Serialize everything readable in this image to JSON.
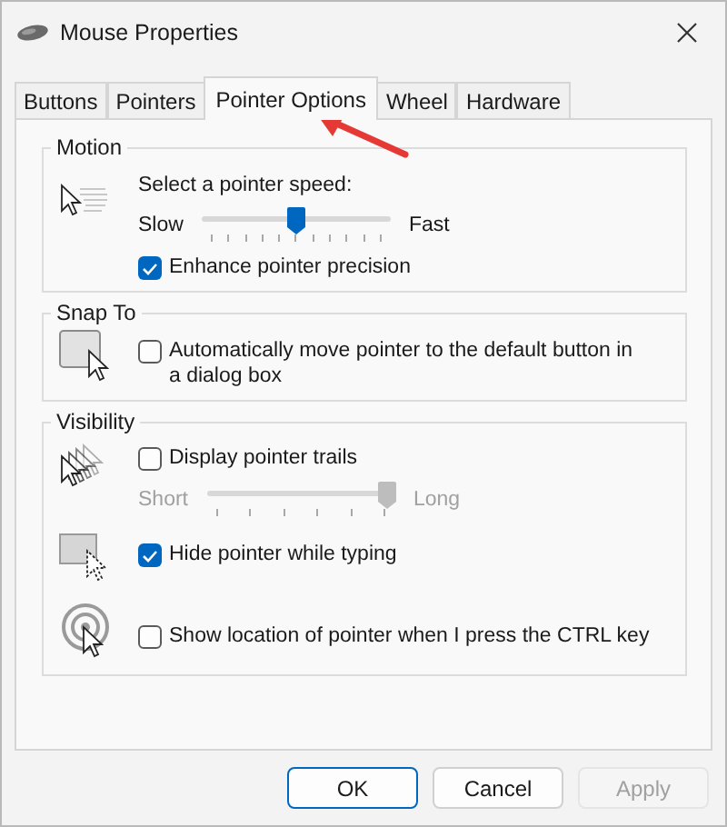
{
  "window": {
    "title": "Mouse Properties"
  },
  "tabs": [
    {
      "label": "Buttons",
      "selected": false
    },
    {
      "label": "Pointers",
      "selected": false
    },
    {
      "label": "Pointer Options",
      "selected": true
    },
    {
      "label": "Wheel",
      "selected": false
    },
    {
      "label": "Hardware",
      "selected": false
    }
  ],
  "motion": {
    "title": "Motion",
    "speed_label": "Select a pointer speed:",
    "slider": {
      "min_label": "Slow",
      "max_label": "Fast",
      "level": 0.5,
      "disabled": false
    },
    "enhance": {
      "label": "Enhance pointer precision",
      "checked": true
    }
  },
  "snap_to": {
    "title": "Snap To",
    "option": {
      "label": "Automatically move pointer to the default button in a dialog box",
      "checked": false
    }
  },
  "visibility": {
    "title": "Visibility",
    "trails": {
      "label": "Display pointer trails",
      "checked": false
    },
    "trail_slider": {
      "min_label": "Short",
      "max_label": "Long",
      "level": 1,
      "disabled": true
    },
    "hide": {
      "label": "Hide pointer while typing",
      "checked": true
    },
    "show_location": {
      "label": "Show location of pointer when I press the CTRL key",
      "checked": false
    }
  },
  "buttons": [
    {
      "label": "OK",
      "default": true,
      "disabled": false
    },
    {
      "label": "Cancel",
      "default": false,
      "disabled": false
    },
    {
      "label": "Apply",
      "default": false,
      "disabled": true
    }
  ]
}
